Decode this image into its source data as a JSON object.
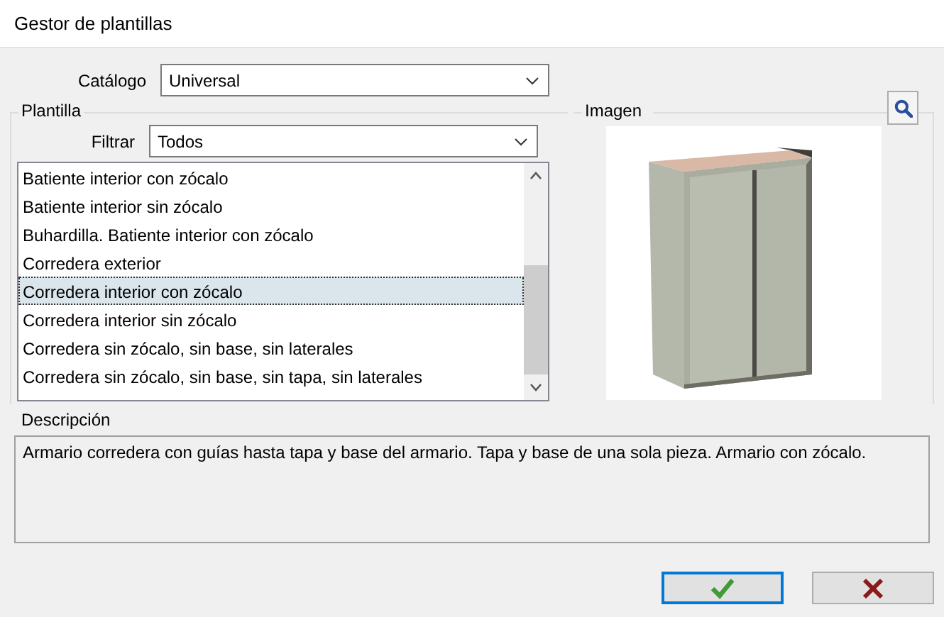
{
  "window": {
    "title": "Gestor de plantillas"
  },
  "catalog": {
    "label": "Catálogo",
    "value": "Universal"
  },
  "template_group": {
    "title": "Plantilla",
    "filter": {
      "label": "Filtrar",
      "value": "Todos"
    },
    "items": [
      {
        "label": "Batiente interior con zócalo",
        "selected": false
      },
      {
        "label": "Batiente interior sin zócalo",
        "selected": false
      },
      {
        "label": "Buhardilla. Batiente interior con zócalo",
        "selected": false
      },
      {
        "label": "Corredera exterior",
        "selected": false
      },
      {
        "label": "Corredera interior con zócalo",
        "selected": true
      },
      {
        "label": "Corredera interior sin zócalo",
        "selected": false
      },
      {
        "label": "Corredera sin zócalo, sin base, sin laterales",
        "selected": false
      },
      {
        "label": "Corredera sin zócalo, sin base, sin tapa, sin laterales",
        "selected": false
      }
    ]
  },
  "image_group": {
    "title": "Imagen"
  },
  "description": {
    "title": "Descripción",
    "text": "Armario corredera con guías hasta tapa y base del armario. Tapa y base de una sola pieza. Armario con zócalo."
  },
  "buttons": [
    {
      "kind": "ok"
    },
    {
      "kind": "cancel"
    }
  ]
}
